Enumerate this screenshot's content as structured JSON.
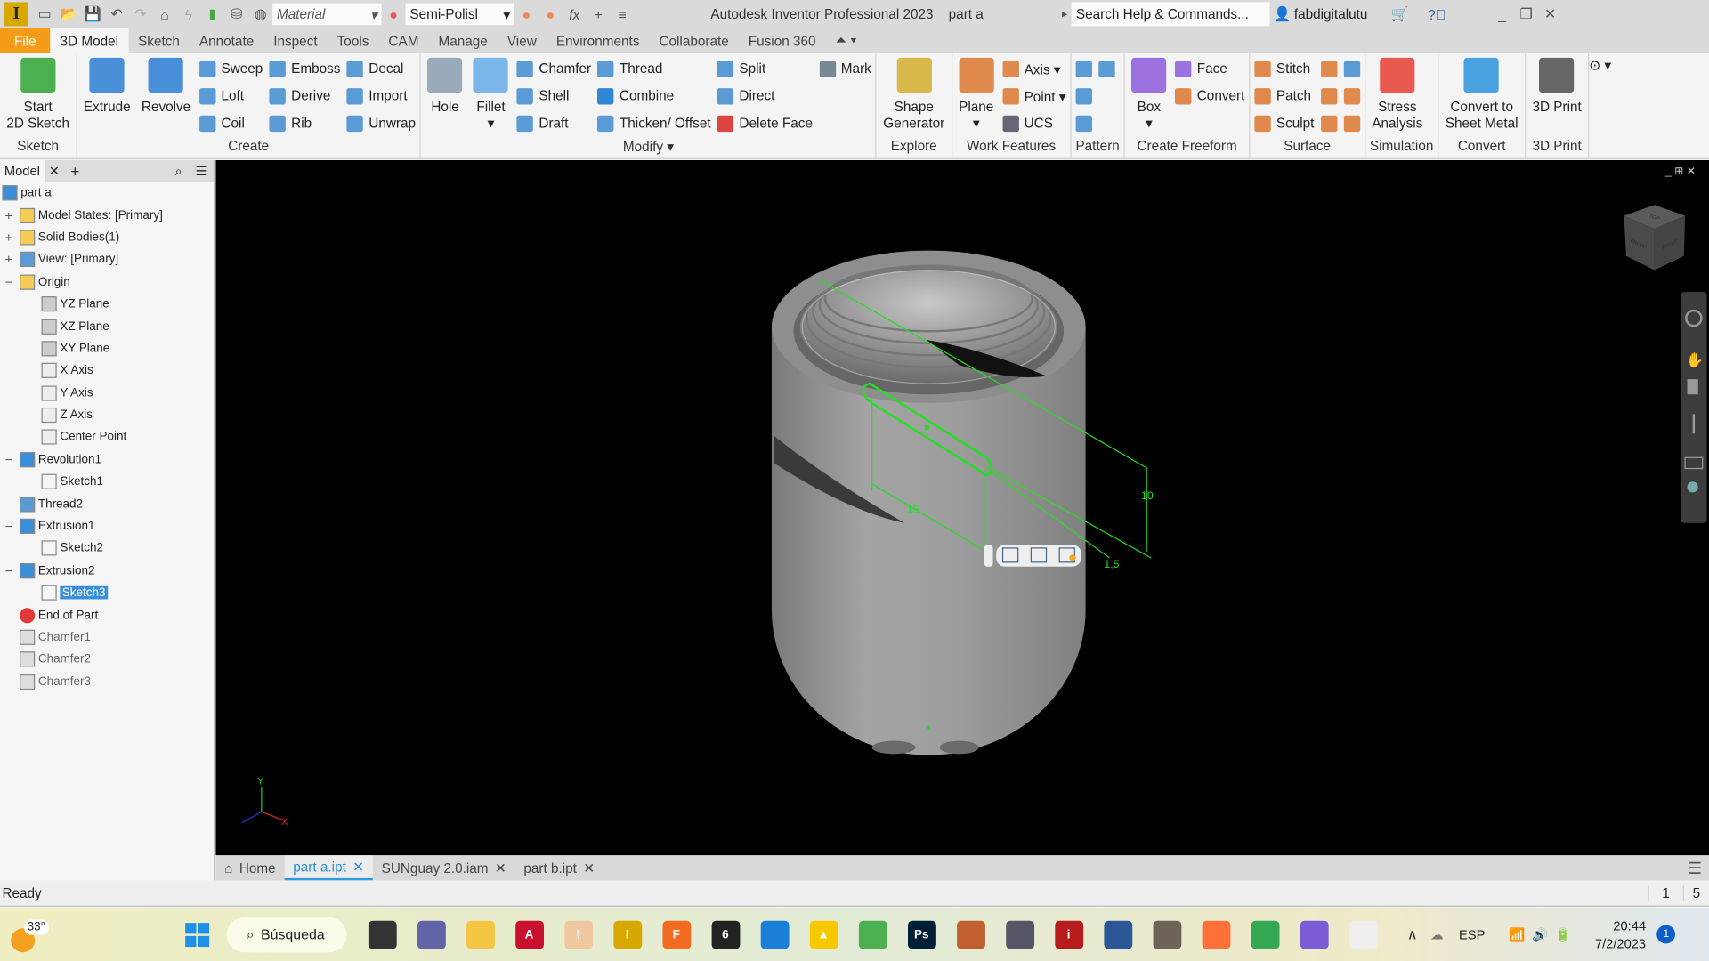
{
  "titlebar": {
    "app_title": "Autodesk Inventor Professional 2023",
    "doc_title": "part a",
    "material": "Material",
    "appearance": "Semi-Polisl",
    "search_placeholder": "Search Help & Commands...",
    "user": "fabdigitalutu",
    "app_icon_letter": "I"
  },
  "ribbon_tabs": [
    "File",
    "3D Model",
    "Sketch",
    "Annotate",
    "Inspect",
    "Tools",
    "CAM",
    "Manage",
    "View",
    "Environments",
    "Collaborate",
    "Fusion 360"
  ],
  "active_tab": "3D Model",
  "panels": [
    {
      "label": "Sketch",
      "columns": [
        {
          "large": {
            "label": "Start\n2D Sketch",
            "icon": "sketch-icon",
            "color": "#4caf50"
          }
        }
      ]
    },
    {
      "label": "Create",
      "columns": [
        {
          "large": {
            "label": "Extrude",
            "icon": "extrude-icon",
            "color": "#4a90d9"
          }
        },
        {
          "large": {
            "label": "Revolve",
            "icon": "revolve-icon",
            "color": "#4a90d9"
          }
        },
        {
          "small": [
            {
              "label": "Sweep",
              "icon": "sweep-icon",
              "color": "#5b9bd5"
            },
            {
              "label": "Loft",
              "icon": "loft-icon",
              "color": "#5b9bd5"
            },
            {
              "label": "Coil",
              "icon": "coil-icon",
              "color": "#5b9bd5"
            }
          ]
        },
        {
          "small": [
            {
              "label": "Emboss",
              "icon": "emboss-icon",
              "color": "#5b9bd5"
            },
            {
              "label": "Derive",
              "icon": "derive-icon",
              "color": "#5b9bd5"
            },
            {
              "label": "Rib",
              "icon": "rib-icon",
              "color": "#5b9bd5"
            }
          ]
        },
        {
          "small": [
            {
              "label": "Decal",
              "icon": "decal-icon",
              "color": "#5b9bd5"
            },
            {
              "label": "Import",
              "icon": "import-icon",
              "color": "#5b9bd5"
            },
            {
              "label": "Unwrap",
              "icon": "unwrap-icon",
              "color": "#5b9bd5"
            }
          ]
        }
      ]
    },
    {
      "label": "Modify ▾",
      "columns": [
        {
          "large": {
            "label": "Hole",
            "icon": "hole-icon",
            "color": "#9ab"
          }
        },
        {
          "large": {
            "label": "Fillet\n▾",
            "icon": "fillet-icon",
            "color": "#7ab6e8"
          }
        },
        {
          "small": [
            {
              "label": "Chamfer",
              "icon": "chamfer-icon",
              "color": "#5b9bd5"
            },
            {
              "label": "Shell",
              "icon": "shell-icon",
              "color": "#5b9bd5"
            },
            {
              "label": "Draft",
              "icon": "draft-icon",
              "color": "#5b9bd5"
            }
          ]
        },
        {
          "small": [
            {
              "label": "Thread",
              "icon": "thread-icon",
              "color": "#5b9bd5"
            },
            {
              "label": "Combine",
              "icon": "combine-icon",
              "color": "#2f86d6"
            },
            {
              "label": "Thicken/ Offset",
              "icon": "thicken-icon",
              "color": "#5b9bd5"
            }
          ]
        },
        {
          "small": [
            {
              "label": "Split",
              "icon": "split-icon",
              "color": "#5b9bd5"
            },
            {
              "label": "Direct",
              "icon": "direct-icon",
              "color": "#5b9bd5"
            },
            {
              "label": "Delete Face",
              "icon": "delete-face-icon",
              "color": "#d44"
            }
          ]
        },
        {
          "small": [
            {
              "label": "Mark",
              "icon": "mark-icon",
              "color": "#789"
            }
          ]
        }
      ]
    },
    {
      "label": "Explore",
      "columns": [
        {
          "large": {
            "label": "Shape\nGenerator",
            "icon": "shape-generator-icon",
            "color": "#d8b84a"
          }
        }
      ]
    },
    {
      "label": "Work Features",
      "columns": [
        {
          "large": {
            "label": "Plane\n▾",
            "icon": "plane-icon",
            "color": "#e0894d"
          }
        },
        {
          "small": [
            {
              "label": "Axis ▾",
              "icon": "axis-icon",
              "color": "#e0894d"
            },
            {
              "label": "Point ▾",
              "icon": "point-icon",
              "color": "#e0894d"
            },
            {
              "label": "UCS",
              "icon": "ucs-icon",
              "color": "#667"
            }
          ]
        }
      ]
    },
    {
      "label": "Pattern",
      "columns": [
        {
          "small": [
            {
              "label": "",
              "icon": "rectangular-pattern-icon",
              "color": "#5b9bd5"
            },
            {
              "label": "",
              "icon": "circular-pattern-icon",
              "color": "#5b9bd5"
            },
            {
              "label": "",
              "icon": "sketch-driven-pattern-icon",
              "color": "#5b9bd5"
            }
          ]
        },
        {
          "small": [
            {
              "label": "",
              "icon": "mirror-icon",
              "color": "#5b9bd5"
            }
          ]
        }
      ]
    },
    {
      "label": "Create Freeform",
      "columns": [
        {
          "large": {
            "label": "Box\n▾",
            "icon": "box-icon",
            "color": "#9b72e0"
          }
        },
        {
          "small": [
            {
              "label": "Face",
              "icon": "face-icon",
              "color": "#9b72e0"
            },
            {
              "label": "Convert",
              "icon": "convert-icon",
              "color": "#e0894d"
            }
          ]
        }
      ]
    },
    {
      "label": "Surface",
      "columns": [
        {
          "small": [
            {
              "label": "Stitch",
              "icon": "stitch-icon",
              "color": "#e0894d"
            },
            {
              "label": "Patch",
              "icon": "patch-icon",
              "color": "#e0894d"
            },
            {
              "label": "Sculpt",
              "icon": "sculpt-icon",
              "color": "#e0894d"
            }
          ]
        },
        {
          "small": [
            {
              "label": "",
              "icon": "trim-icon",
              "color": "#e0894d"
            },
            {
              "label": "",
              "icon": "delete-icon",
              "color": "#e0894d"
            },
            {
              "label": "",
              "icon": "extend-icon",
              "color": "#e0894d"
            }
          ]
        },
        {
          "small": [
            {
              "label": "",
              "icon": "boundary-patch-icon",
              "color": "#5b9bd5"
            },
            {
              "label": "",
              "icon": "replace-face-icon",
              "color": "#e0894d"
            },
            {
              "label": "",
              "icon": "repair-icon",
              "color": "#e0894d"
            }
          ]
        }
      ]
    },
    {
      "label": "Simulation",
      "columns": [
        {
          "large": {
            "label": "Stress\nAnalysis",
            "icon": "stress-analysis-icon",
            "color": "#e85a4f"
          }
        }
      ]
    },
    {
      "label": "Convert",
      "columns": [
        {
          "large": {
            "label": "Convert to\nSheet Metal",
            "icon": "sheet-metal-icon",
            "color": "#4aa3e0"
          }
        }
      ]
    },
    {
      "label": "3D Print",
      "columns": [
        {
          "large": {
            "label": "3D Print",
            "icon": "3d-print-icon",
            "color": "#666"
          }
        }
      ]
    }
  ],
  "browser": {
    "tab": "Model",
    "items": [
      {
        "label": "part a",
        "level": 0,
        "exp": "",
        "icon": "part-icon",
        "color": "#3b8fd8"
      },
      {
        "label": "Model States: [Primary]",
        "level": 1,
        "exp": "+",
        "icon": "folder-icon",
        "color": "#f5cc55"
      },
      {
        "label": "Solid Bodies(1)",
        "level": 1,
        "exp": "+",
        "icon": "folder-icon",
        "color": "#f5cc55"
      },
      {
        "label": "View: [Primary]",
        "level": 1,
        "exp": "+",
        "icon": "view-icon",
        "color": "#5b9bd5"
      },
      {
        "label": "Origin",
        "level": 1,
        "exp": "−",
        "icon": "folder-open-icon",
        "color": "#f5cc55"
      },
      {
        "label": "YZ Plane",
        "level": 2,
        "exp": "",
        "icon": "plane-icon",
        "color": "#ccc"
      },
      {
        "label": "XZ Plane",
        "level": 2,
        "exp": "",
        "icon": "plane-icon",
        "color": "#ccc"
      },
      {
        "label": "XY Plane",
        "level": 2,
        "exp": "",
        "icon": "plane-icon",
        "color": "#ccc"
      },
      {
        "label": "X Axis",
        "level": 2,
        "exp": "",
        "icon": "axis-icon",
        "color": "#eee"
      },
      {
        "label": "Y Axis",
        "level": 2,
        "exp": "",
        "icon": "axis-icon",
        "color": "#eee"
      },
      {
        "label": "Z Axis",
        "level": 2,
        "exp": "",
        "icon": "axis-icon",
        "color": "#eee"
      },
      {
        "label": "Center Point",
        "level": 2,
        "exp": "",
        "icon": "center-point-icon",
        "color": "#eee"
      },
      {
        "label": "Revolution1",
        "level": 1,
        "exp": "−",
        "icon": "revolve-icon",
        "color": "#3b8fd8"
      },
      {
        "label": "Sketch1",
        "level": 2,
        "exp": "",
        "icon": "sketch-icon",
        "color": "#f5f5f5"
      },
      {
        "label": "Thread2",
        "level": 1,
        "exp": "",
        "icon": "thread-icon",
        "color": "#5b9bd5"
      },
      {
        "label": "Extrusion1",
        "level": 1,
        "exp": "−",
        "icon": "extrude-icon",
        "color": "#3b8fd8"
      },
      {
        "label": "Sketch2",
        "level": 2,
        "exp": "",
        "icon": "sketch-icon",
        "color": "#f5f5f5"
      },
      {
        "label": "Extrusion2",
        "level": 1,
        "exp": "−",
        "icon": "extrude-icon",
        "color": "#3b8fd8"
      },
      {
        "label": "Sketch3",
        "level": 2,
        "exp": "",
        "icon": "sketch-icon",
        "color": "#f5f5f5",
        "selected": true
      },
      {
        "label": "End of Part",
        "level": 1,
        "exp": "",
        "icon": "end-of-part-icon",
        "color": "#e03a3a"
      },
      {
        "label": "Chamfer1",
        "level": 1,
        "exp": "",
        "icon": "chamfer-icon",
        "color": "#ddd",
        "dim": true
      },
      {
        "label": "Chamfer2",
        "level": 1,
        "exp": "",
        "icon": "chamfer-icon",
        "color": "#ddd",
        "dim": true
      },
      {
        "label": "Chamfer3",
        "level": 1,
        "exp": "",
        "icon": "chamfer-icon",
        "color": "#ddd",
        "dim": true
      }
    ]
  },
  "viewport": {
    "dimensions": [
      "10",
      "15",
      "1,5"
    ],
    "viewcube": {
      "top": "TOP",
      "front": "FRONT",
      "right": "RIGHT"
    },
    "axis_labels": {
      "y": "Y",
      "x": "X"
    },
    "sketch_color": "#22e022"
  },
  "doc_tabs": [
    {
      "label": "Home",
      "icon": "home-icon"
    },
    {
      "label": "part a.ipt",
      "active": true
    },
    {
      "label": "SUNguay 2.0.iam"
    },
    {
      "label": "part b.ipt"
    }
  ],
  "status": {
    "text": "Ready",
    "count1": "1",
    "count2": "5"
  },
  "taskbar": {
    "weather": "33°",
    "search": "Búsqueda",
    "lang": "ESP",
    "time": "20:44",
    "date": "7/2/2023",
    "notifications": "1",
    "apps": [
      {
        "name": "task-view",
        "color": "#333",
        "text": ""
      },
      {
        "name": "teams",
        "color": "#6264a7",
        "text": ""
      },
      {
        "name": "file-explorer",
        "color": "#f4c542",
        "text": ""
      },
      {
        "name": "autocad",
        "color": "#c8102e",
        "text": "A"
      },
      {
        "name": "inventor-pro-alt",
        "color": "#f0c8a0",
        "text": "I"
      },
      {
        "name": "inventor-pro",
        "color": "#d8a800",
        "text": "I"
      },
      {
        "name": "fusion-360",
        "color": "#f26b21",
        "text": "F"
      },
      {
        "name": "rhino",
        "color": "#222",
        "text": "6"
      },
      {
        "name": "keyshot",
        "color": "#1a7fd6",
        "text": ""
      },
      {
        "name": "vlc-like",
        "color": "#f7c800",
        "text": "▲"
      },
      {
        "name": "corel",
        "color": "#4caf50",
        "text": ""
      },
      {
        "name": "photoshop",
        "color": "#001e36",
        "text": "Ps"
      },
      {
        "name": "pencil",
        "color": "#c06030",
        "text": ""
      },
      {
        "name": "calculator",
        "color": "#556",
        "text": ""
      },
      {
        "name": "acrobat-like",
        "color": "#b71c1c",
        "text": "i"
      },
      {
        "name": "virtualbox",
        "color": "#2b5797",
        "text": ""
      },
      {
        "name": "gimp",
        "color": "#6d6458",
        "text": ""
      },
      {
        "name": "firefox",
        "color": "#ff7139",
        "text": ""
      },
      {
        "name": "chrome",
        "color": "#34a853",
        "text": ""
      },
      {
        "name": "clipchamp",
        "color": "#7b5cd6",
        "text": ""
      },
      {
        "name": "gimp-white",
        "color": "#eee",
        "text": ""
      }
    ]
  }
}
